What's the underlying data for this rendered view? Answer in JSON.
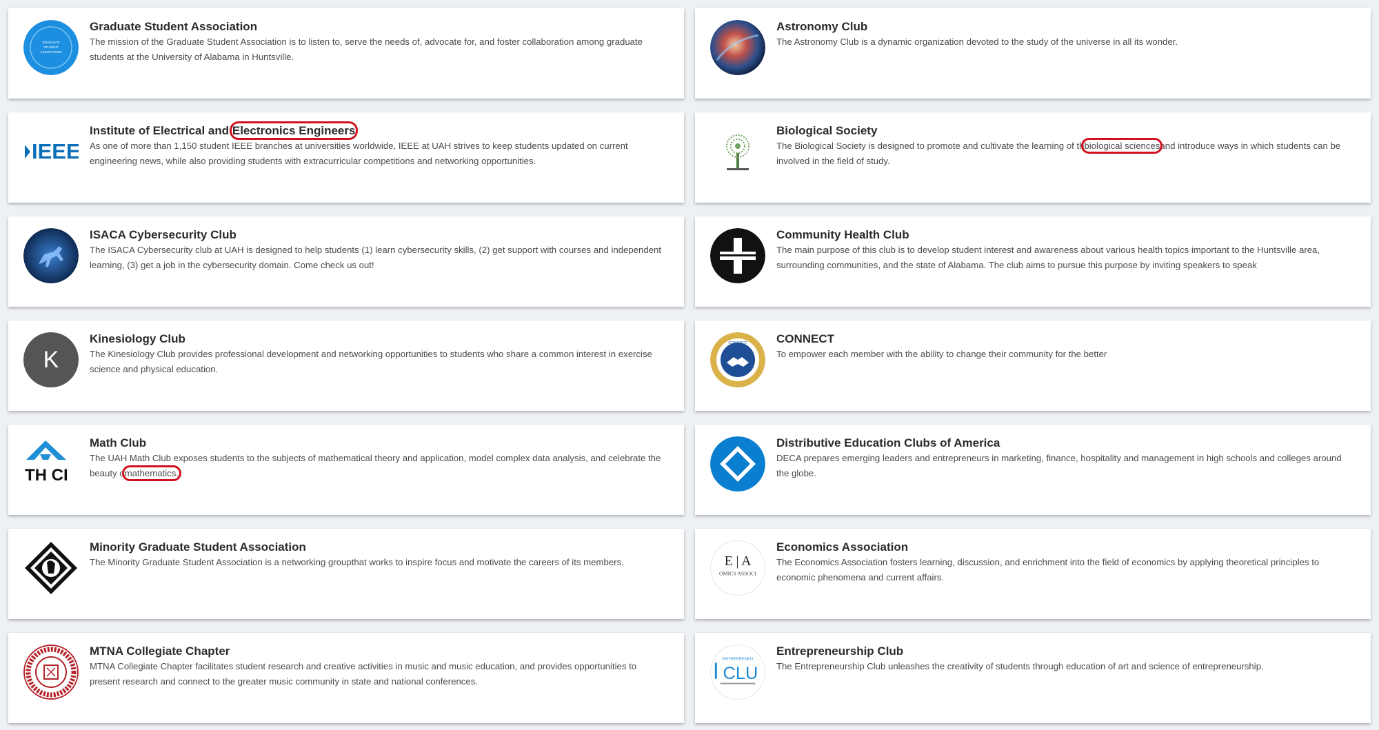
{
  "orgs": [
    {
      "name": "Graduate Student Association",
      "desc": "The mission of the Graduate Student Association is to listen to, serve the needs of, advocate for, and foster collaboration among graduate students at the University of Alabama in Huntsville.",
      "logo_icon": "gsa-seal-icon",
      "logo_text": "GRADUATE STUDENT ASSOCIATION",
      "color": "#1c8fe0"
    },
    {
      "name": "Astronomy Club",
      "desc": "The Astronomy Club is a dynamic organization devoted to the study of the universe in all its wonder.",
      "logo_icon": "nebula-icon",
      "color": "#1a2a55"
    },
    {
      "name_pre": "Institute of Electrical and ",
      "name_hl": "Electronics Engineers",
      "desc": "As one of more than 1,150 student IEEE branches at universities worldwide, IEEE at UAH strives to keep students updated on current engineering news, while also providing students with extracurricular competitions and networking opportunities.",
      "logo_icon": "ieee-logo-icon",
      "logo_text": "IEEE",
      "color": "#0a6fb8"
    },
    {
      "name": "Biological Society",
      "desc_pre": "The Biological Society is designed to promote and cultivate the learning of th",
      "desc_hl": "biological sciences",
      "desc_post": "and introduce ways in which students can be involved in the field of study.",
      "logo_icon": "tree-icon",
      "color": "#6fa35a"
    },
    {
      "name": "ISACA Cybersecurity Club",
      "desc": "The ISACA Cybersecurity club at UAH is designed to help students (1) learn cybersecurity skills, (2) get support with courses and independent learning, (3) get a job in the cybersecurity domain. Come check us out!",
      "logo_icon": "horse-icon",
      "color": "#0d2e5c"
    },
    {
      "name": "Community Health Club",
      "desc": "The main purpose of this club is to develop student interest and awareness about various health topics important to the Huntsville area, surrounding communities, and the state of Alabama. The club aims to pursue this purpose by inviting speakers to speak",
      "logo_icon": "cross-icon",
      "color": "#111111"
    },
    {
      "name": "Kinesiology Club",
      "desc": "The Kinesiology Club provides professional development and networking opportunities to students who share a common interest in exercise science and physical education.",
      "logo_icon": "letter-avatar-icon",
      "logo_text": "K",
      "color": "#555555"
    },
    {
      "name": "CONNECT",
      "desc": "To empower each member with the ability to change their community for the better",
      "logo_icon": "handshake-icon",
      "logo_text": "CONNECT",
      "color": "#d9b24a"
    },
    {
      "name": "Math Club",
      "desc_pre": "The UAH Math Club exposes students to the subjects of mathematical theory and application, model complex data analysis, and celebrate the beauty o",
      "desc_hl": "mathematics.",
      "desc_post": "",
      "logo_icon": "math-club-logo-icon",
      "logo_text": "TH CI",
      "color": "#1f8fd6"
    },
    {
      "name": "Distributive Education Clubs of America",
      "desc": "DECA prepares emerging leaders and entrepreneurs in marketing, finance, hospitality and management in high schools and colleges around the globe.",
      "logo_icon": "diamond-icon",
      "color": "#0a7fd0"
    },
    {
      "name": "Minority Graduate Student Association",
      "desc": "The Minority Graduate Student Association is a networking groupthat works to inspire focus and motivate the careers of its members.",
      "logo_icon": "mgsa-diamond-icon",
      "color": "#111111"
    },
    {
      "name": "Economics Association",
      "desc": "The Economics Association fosters learning, discussion, and enrichment into the field of economics by applying theoretical principles to economic phenomena and current affairs.",
      "logo_icon": "ea-logo-icon",
      "logo_text": "E | A",
      "logo_sub": "OMICS ASSOCI",
      "color": "#333333"
    },
    {
      "name": "MTNA Collegiate Chapter",
      "desc": "MTNA Collegiate Chapter facilitates student research and creative activities in music and music education, and provides opportunities to present research and connect to the greater music community in state and national conferences.",
      "logo_icon": "mtna-seal-icon",
      "color": "#b4232a"
    },
    {
      "name": "Entrepreneurship Club",
      "desc": "The Entrepreneurship Club unleashes the creativity of students through education of art and science of entrepreneurship.",
      "logo_icon": "clu-logo-icon",
      "logo_text": "CLU",
      "logo_sub": "ENTREPRENEU",
      "color": "#1b8ad0"
    }
  ]
}
